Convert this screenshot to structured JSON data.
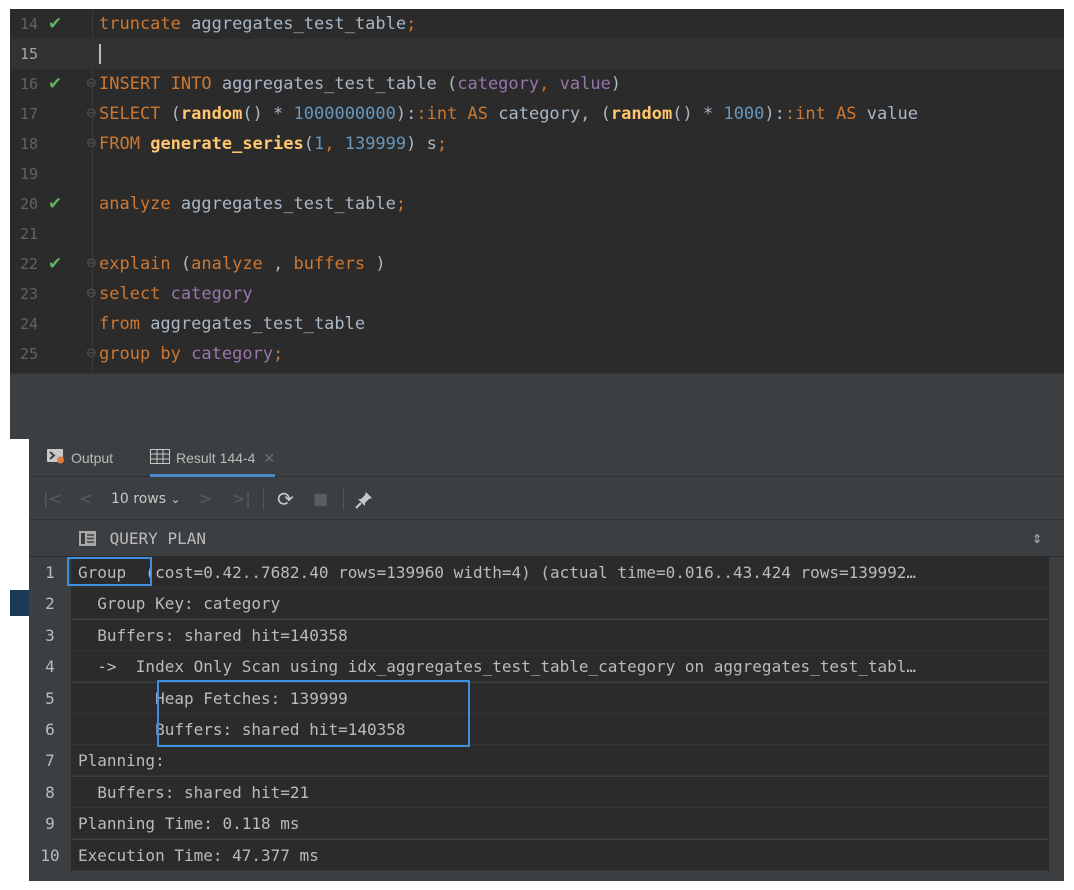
{
  "editor": {
    "lines": [
      {
        "n": "14",
        "check": true,
        "fold": "",
        "tokens": [
          [
            "kw",
            "truncate"
          ],
          [
            "plain",
            " aggregates_test_table"
          ],
          [
            "kw",
            ";"
          ]
        ]
      },
      {
        "n": "15",
        "check": false,
        "fold": "",
        "current": true,
        "tokens": []
      },
      {
        "n": "16",
        "check": true,
        "fold": "⊖",
        "tokens": [
          [
            "kw",
            "INSERT INTO"
          ],
          [
            "plain",
            " aggregates_test_table ("
          ],
          [
            "col",
            "category"
          ],
          [
            "kw",
            ", "
          ],
          [
            "col",
            "value"
          ],
          [
            "plain",
            ")"
          ]
        ]
      },
      {
        "n": "17",
        "check": false,
        "fold": "⊖",
        "tokens": [
          [
            "kw",
            "SELECT"
          ],
          [
            "plain",
            " ("
          ],
          [
            "fn",
            "random"
          ],
          [
            "plain",
            "() * "
          ],
          [
            "num",
            "1000000000"
          ],
          [
            "plain",
            "):"
          ],
          [
            "kw",
            ":int AS"
          ],
          [
            "plain",
            " category, ("
          ],
          [
            "fn",
            "random"
          ],
          [
            "plain",
            "() * "
          ],
          [
            "num",
            "1000"
          ],
          [
            "plain",
            "):"
          ],
          [
            "kw",
            ":int AS"
          ],
          [
            "plain",
            " value"
          ]
        ]
      },
      {
        "n": "18",
        "check": false,
        "fold": "⊖",
        "tokens": [
          [
            "kw",
            "FROM"
          ],
          [
            "plain",
            " "
          ],
          [
            "fn",
            "generate_series"
          ],
          [
            "plain",
            "("
          ],
          [
            "num",
            "1"
          ],
          [
            "kw",
            ", "
          ],
          [
            "num",
            "139999"
          ],
          [
            "plain",
            ") s"
          ],
          [
            "kw",
            ";"
          ]
        ]
      },
      {
        "n": "19",
        "check": false,
        "fold": "",
        "tokens": []
      },
      {
        "n": "20",
        "check": true,
        "fold": "",
        "tokens": [
          [
            "kw",
            "analyze"
          ],
          [
            "plain",
            " aggregates_test_table"
          ],
          [
            "kw",
            ";"
          ]
        ]
      },
      {
        "n": "21",
        "check": false,
        "fold": "",
        "tokens": []
      },
      {
        "n": "22",
        "check": true,
        "fold": "⊖",
        "tokens": [
          [
            "kw",
            "explain"
          ],
          [
            "plain",
            " ("
          ],
          [
            "kw",
            "analyze"
          ],
          [
            "plain",
            " , "
          ],
          [
            "kw",
            "buffers"
          ],
          [
            "plain",
            " )"
          ]
        ]
      },
      {
        "n": "23",
        "check": false,
        "fold": "⊖",
        "tokens": [
          [
            "kw",
            "select"
          ],
          [
            "plain",
            " "
          ],
          [
            "col",
            "category"
          ]
        ]
      },
      {
        "n": "24",
        "check": false,
        "fold": "",
        "tokens": [
          [
            "kw",
            "from"
          ],
          [
            "plain",
            " aggregates_test_table"
          ]
        ]
      },
      {
        "n": "25",
        "check": false,
        "fold": "⊖",
        "tokens": [
          [
            "kw",
            "group by"
          ],
          [
            "plain",
            " "
          ],
          [
            "col",
            "category"
          ],
          [
            "kw",
            ";"
          ]
        ]
      }
    ]
  },
  "tabs": {
    "output_label": "Output",
    "result_label": "Result 144-4"
  },
  "toolbar": {
    "rows_label": "10 rows"
  },
  "grid": {
    "column_header": "QUERY PLAN",
    "rows": [
      {
        "n": "1",
        "text": "Group  (cost=0.42..7682.40 rows=139960 width=4) (actual time=0.016..43.424 rows=139992…"
      },
      {
        "n": "2",
        "text": "  Group Key: category"
      },
      {
        "n": "3",
        "text": "  Buffers: shared hit=140358"
      },
      {
        "n": "4",
        "text": "  ->  Index Only Scan using idx_aggregates_test_table_category on aggregates_test_tabl…"
      },
      {
        "n": "5",
        "text": "        Heap Fetches: 139999"
      },
      {
        "n": "6",
        "text": "        Buffers: shared hit=140358"
      },
      {
        "n": "7",
        "text": "Planning:"
      },
      {
        "n": "8",
        "text": "  Buffers: shared hit=21"
      },
      {
        "n": "9",
        "text": "Planning Time: 0.118 ms"
      },
      {
        "n": "10",
        "text": "Execution Time: 47.377 ms"
      }
    ]
  }
}
